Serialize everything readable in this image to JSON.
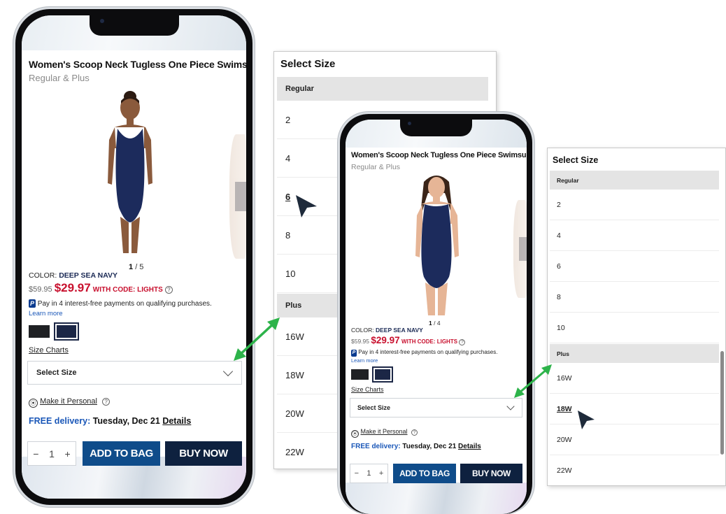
{
  "product": {
    "title": "Women's Scoop Neck Tugless One Piece Swimsuit",
    "subtitle": "Regular & Plus",
    "color_label": "COLOR:",
    "color_value": "DEEP SEA NAVY",
    "old_price": "$59.95",
    "new_price": "$29.97",
    "promo": "WITH CODE: LIGHTS",
    "help_icon": "?",
    "paypal_text": "Pay in 4 interest-free payments on qualifying purchases.",
    "paypal_icon": "P",
    "learn_more": "Learn more",
    "size_charts": "Size Charts",
    "select_size": "Select Size",
    "make_personal": "Make it Personal",
    "free_delivery": "FREE delivery:",
    "delivery_date": "Tuesday, Dec 21",
    "details": "Details",
    "qty_minus": "−",
    "qty_value": "1",
    "qty_plus": "+",
    "add_to_bag": "ADD TO BAG",
    "buy_now": "BUY NOW"
  },
  "phone1": {
    "page_current": "1",
    "page_total": "/ 5",
    "swatch_colors": [
      "#1f2124",
      "#1c2746"
    ]
  },
  "phone2": {
    "page_current": "1",
    "page_total": "/ 4"
  },
  "size_panel": {
    "title": "Select Size",
    "regular_label": "Regular",
    "plus_label": "Plus",
    "regular_sizes": [
      "2",
      "4",
      "6",
      "8",
      "10"
    ],
    "plus_sizes": [
      "16W",
      "18W",
      "20W",
      "22W"
    ]
  },
  "panel1": {
    "selected": "6"
  },
  "panel2": {
    "selected": "18W"
  },
  "colors": {
    "accent_red": "#c8102e",
    "button_blue": "#0f4c8a",
    "button_navy": "#0e213f",
    "arrow_green": "#2db34a",
    "link_blue": "#1a57b8"
  }
}
